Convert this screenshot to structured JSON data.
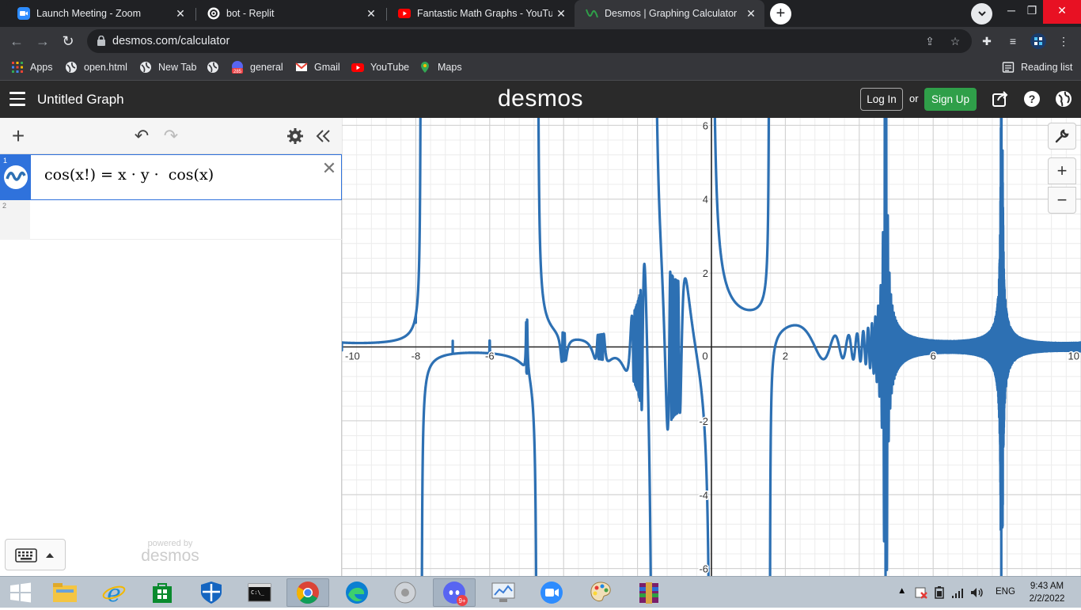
{
  "browser": {
    "tabs": [
      {
        "title": "Launch Meeting - Zoom",
        "icon": "zoom-icon",
        "active": false
      },
      {
        "title": "bot - Replit",
        "icon": "replit-icon",
        "active": false
      },
      {
        "title": "Fantastic Math Graphs - YouTube",
        "icon": "youtube-icon",
        "active": false
      },
      {
        "title": "Desmos | Graphing Calculator",
        "icon": "desmos-icon",
        "active": true
      }
    ],
    "url": "desmos.com/calculator",
    "bookmarks": [
      {
        "label": "Apps",
        "icon": "apps-grid-icon"
      },
      {
        "label": "open.html",
        "icon": "globe-icon"
      },
      {
        "label": "New Tab",
        "icon": "globe-icon"
      },
      {
        "label": "",
        "icon": "globe-icon"
      },
      {
        "label": "general",
        "icon": "discord-badge-icon",
        "badge": "285"
      },
      {
        "label": "Gmail",
        "icon": "gmail-icon"
      },
      {
        "label": "YouTube",
        "icon": "youtube-icon"
      },
      {
        "label": "Maps",
        "icon": "maps-icon"
      }
    ],
    "reading_list": "Reading list"
  },
  "desmos": {
    "graph_title": "Untitled Graph",
    "logo": "desmos",
    "login_label": "Log In",
    "or_label": "or",
    "signup_label": "Sign Up",
    "expressions": [
      {
        "row": "1",
        "latex_display": "cos(x!) = x · y ·  cos(x)",
        "color": "#2d70b3"
      },
      {
        "row": "2",
        "latex_display": ""
      }
    ],
    "powered_by": "powered by",
    "powered_logo": "desmos",
    "zoom_in": "+",
    "zoom_out": "−"
  },
  "chart_data": {
    "type": "line",
    "equation": "cos(x!) = x·y·cos(x)",
    "series_color": "#2d70b3",
    "xlim": [
      -10.0,
      10.0
    ],
    "ylim": [
      -6.2,
      6.2
    ],
    "x_ticks": [
      -10,
      -8,
      -6,
      -4,
      -2,
      0,
      2,
      4,
      6,
      8,
      10
    ],
    "x_tick_labels": [
      "-10",
      "-8",
      "-6",
      "",
      "",
      "0",
      "2",
      "",
      "6",
      "",
      "10"
    ],
    "y_ticks": [
      -6,
      -4,
      -2,
      2,
      4,
      6
    ],
    "y_tick_labels": [
      "-6",
      "-4",
      "-2",
      "2",
      "4",
      "6"
    ],
    "grid": true
  },
  "taskbar": {
    "apps": [
      "start-icon",
      "file-explorer-icon",
      "internet-explorer-icon",
      "store-icon",
      "defender-icon",
      "cmd-icon",
      "chrome-icon",
      "edge-icon",
      "media-icon",
      "discord-icon",
      "monitor-icon",
      "zoom-icon",
      "paint-icon",
      "winrar-icon"
    ],
    "discord_badge": "9+",
    "language": "ENG",
    "time": "9:43 AM",
    "date": "2/2/2022"
  }
}
